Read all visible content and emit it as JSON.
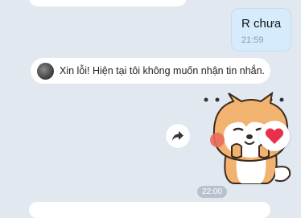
{
  "messages": {
    "sent": {
      "text": "R chưa",
      "time": "21:59"
    },
    "system_notice": {
      "text": "Xin lỗi! Hiện tại tôi không muốn nhận tin nhắn."
    },
    "sticker": {
      "time": "22:00",
      "reaction_icon": "heart-icon",
      "sticker_name": "shiba-dog-sticker"
    }
  },
  "colors": {
    "background": "#e2e8ef",
    "sent_bubble": "#d6ecfd",
    "time_pill": "#b8c2cc",
    "heart": "#e8304a"
  }
}
